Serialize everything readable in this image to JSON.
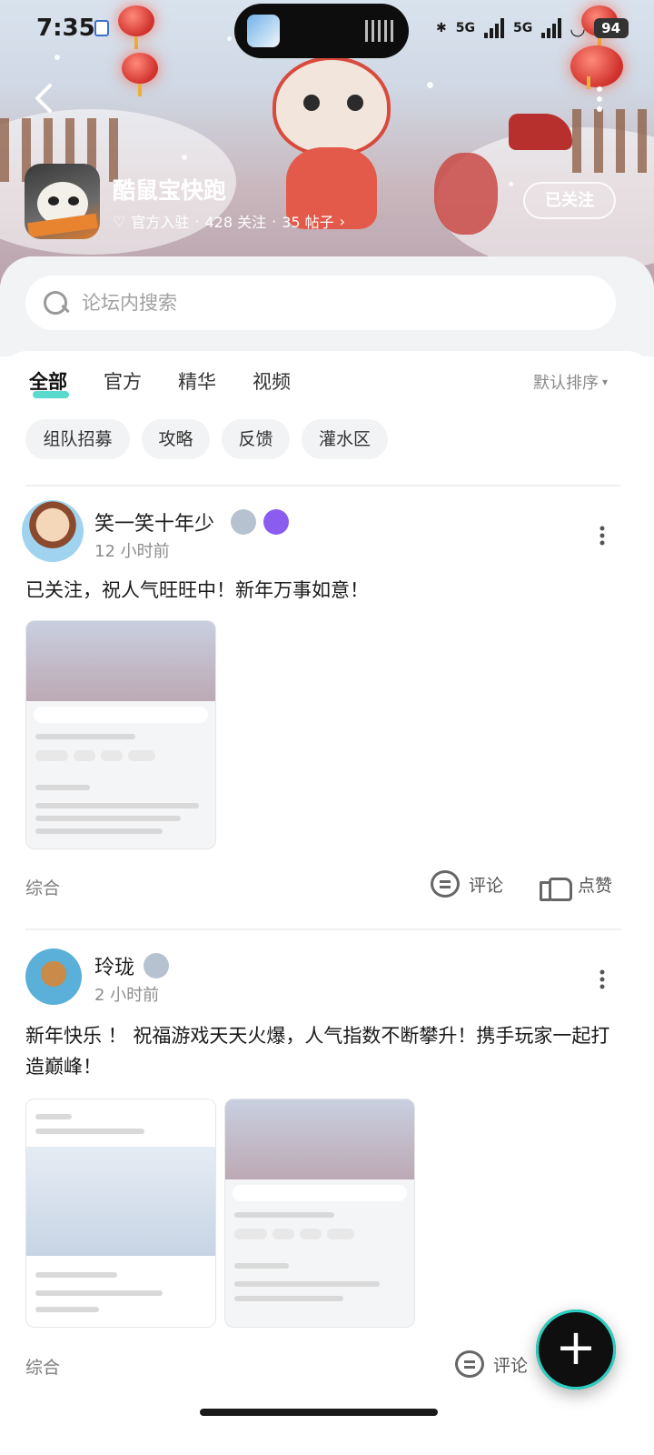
{
  "status_bar": {
    "time": "7:35",
    "network_1": "5G",
    "network_2": "5G",
    "battery": "94"
  },
  "forum": {
    "name": "酷鼠宝快跑",
    "verified_label": "官方入驻",
    "follow_count": "428 关注",
    "post_count": "35 帖子",
    "separator": "·",
    "follow_button": "已关注"
  },
  "search": {
    "placeholder": "论坛内搜索"
  },
  "tabs": [
    {
      "label": "全部",
      "active": true
    },
    {
      "label": "官方",
      "active": false
    },
    {
      "label": "精华",
      "active": false
    },
    {
      "label": "视频",
      "active": false
    }
  ],
  "sort": {
    "label": "默认排序"
  },
  "chips": [
    "组队招募",
    "攻略",
    "反馈",
    "灌水区"
  ],
  "posts": [
    {
      "user": "笑一笑十年少",
      "time": "12 小时前",
      "text": "已关注，祝人气旺旺中！新年万事如意！",
      "tag": "综合",
      "comment_label": "评论",
      "like_label": "点赞"
    },
    {
      "user": "玲珑",
      "time": "2 小时前",
      "text": "新年快乐 ！ 祝福游戏天天火爆，人气指数不断攀升！携手玩家一起打造巅峰！",
      "tag": "综合",
      "comment_label": "评论"
    }
  ],
  "colors": {
    "accent": "#2fd1c1",
    "banner_red": "#d0312c",
    "text_primary": "#1a1a1a",
    "text_secondary": "#8c8c8c"
  },
  "icons": {
    "back": "chevron-left-icon",
    "more": "more-vertical-icon",
    "search": "search-icon",
    "comment": "comment-icon",
    "like": "thumbs-up-icon",
    "fab": "plus-icon"
  },
  "fab": {
    "label": "+"
  }
}
